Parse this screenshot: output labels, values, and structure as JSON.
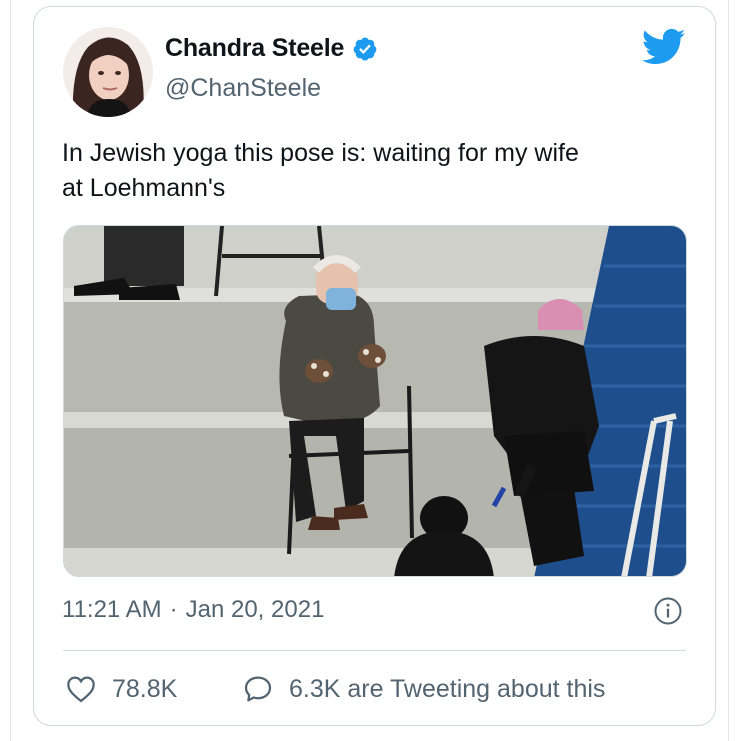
{
  "author": {
    "display_name": "Chandra Steele",
    "handle": "@ChanSteele",
    "verified": true
  },
  "tweet": {
    "text": "In Jewish yoga this pose is: waiting for my wife\nat Loehmann's",
    "time": "11:21 AM",
    "separator": "·",
    "date": "Jan 20, 2021"
  },
  "actions": {
    "likes": "78.8K",
    "reply_text": "6.3K are Tweeting about this"
  },
  "icons": [
    "verified-badge-icon",
    "twitter-bird-icon",
    "info-icon",
    "heart-icon",
    "speech-bubble-icon"
  ],
  "colors": {
    "brand_blue": "#1d9bf0",
    "text_primary": "#0f1419",
    "text_secondary": "#536471",
    "border": "#cfd9de"
  }
}
